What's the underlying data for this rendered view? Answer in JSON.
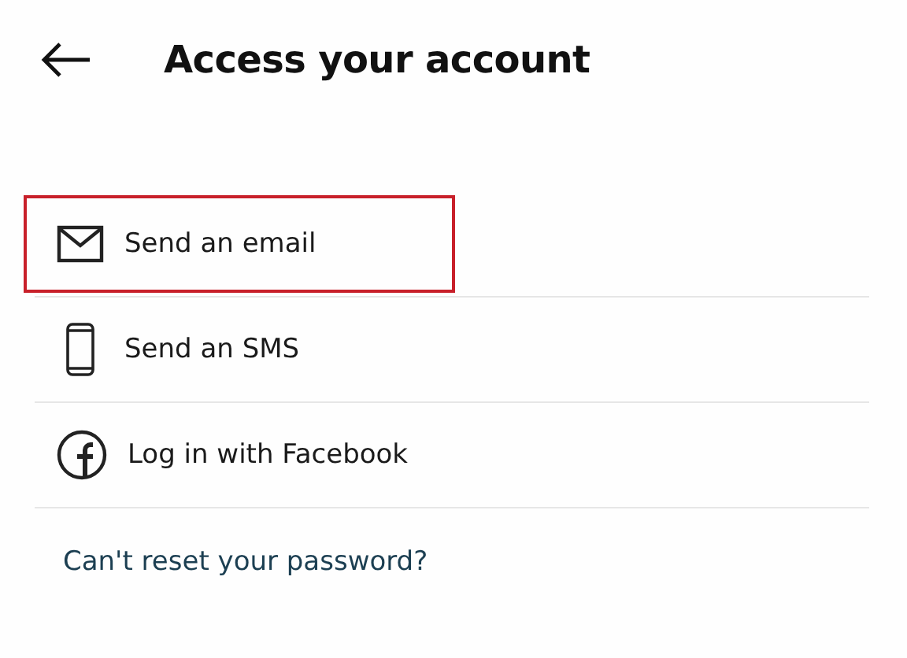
{
  "header": {
    "title": "Access your account"
  },
  "options": [
    {
      "kind": "email",
      "label": "Send an email",
      "highlighted": true
    },
    {
      "kind": "sms",
      "label": "Send an SMS",
      "highlighted": false
    },
    {
      "kind": "facebook",
      "label": "Log in with Facebook",
      "highlighted": false
    }
  ],
  "help_link": "Can't reset your password?"
}
